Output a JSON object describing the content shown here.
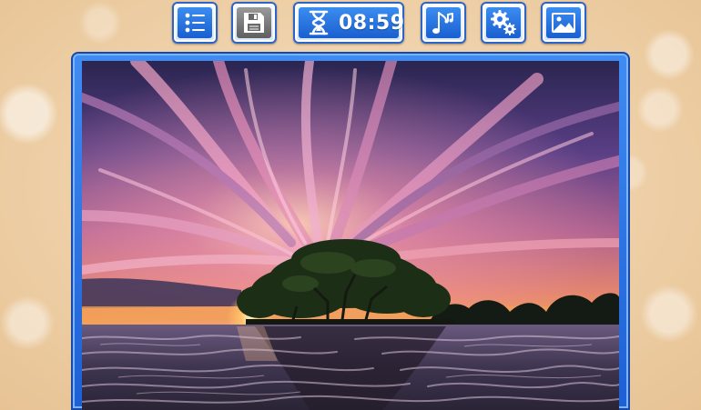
{
  "toolbar": {
    "timer": {
      "value": "08:59",
      "icon": "hourglass-icon"
    },
    "buttons": [
      {
        "id": "menu",
        "icon": "list-icon"
      },
      {
        "id": "save",
        "icon": "floppy-disk-icon"
      },
      {
        "id": "music",
        "icon": "music-note-icon"
      },
      {
        "id": "settings",
        "icon": "gears-icon"
      },
      {
        "id": "picture",
        "icon": "image-icon"
      }
    ]
  },
  "board": {
    "image": "sunset-over-tidal-flat-with-tree"
  },
  "colors": {
    "button_blue": "#2a76e6",
    "button_border": "#2d64c8",
    "save_gray": "#7a7a7a",
    "frame_blue": "#2f74e6",
    "background_peach": "#eed0a8"
  }
}
